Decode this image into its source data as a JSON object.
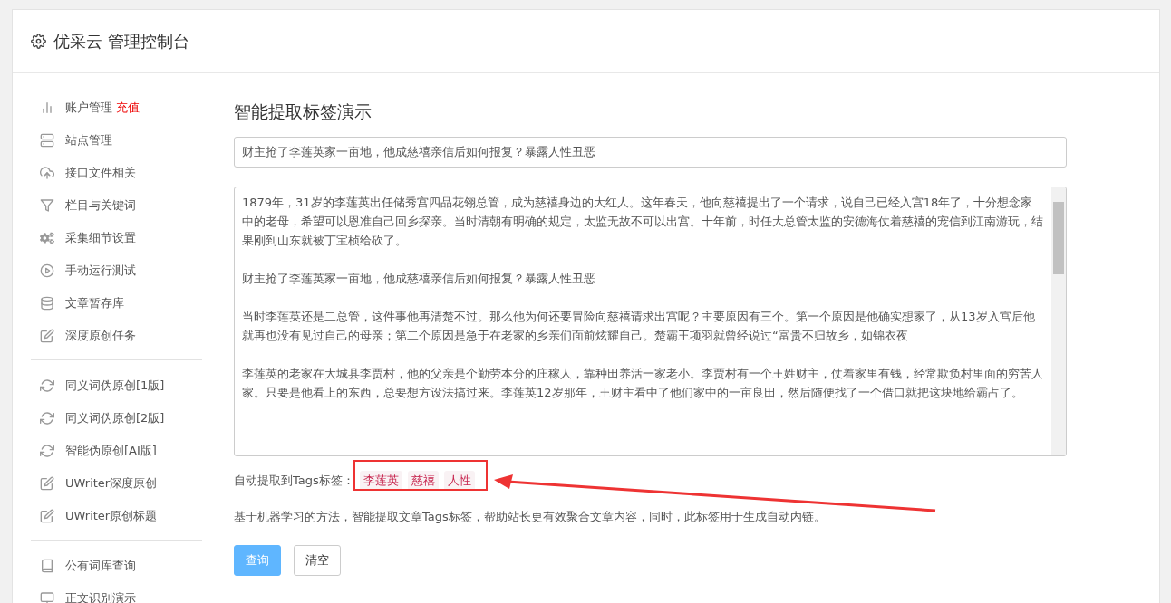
{
  "header": {
    "title": "优采云 管理控制台"
  },
  "sidebar": {
    "groups": [
      {
        "items": [
          {
            "label": "账户管理",
            "badge": "充值"
          },
          {
            "label": "站点管理"
          },
          {
            "label": "接口文件相关"
          },
          {
            "label": "栏目与关键词"
          },
          {
            "label": "采集细节设置"
          },
          {
            "label": "手动运行测试"
          },
          {
            "label": "文章暂存库"
          },
          {
            "label": "深度原创任务"
          }
        ]
      },
      {
        "items": [
          {
            "label": "同义词伪原创[1版]"
          },
          {
            "label": "同义词伪原创[2版]"
          },
          {
            "label": "智能伪原创[AI版]"
          },
          {
            "label": "UWriter深度原创"
          },
          {
            "label": "UWriter原创标题"
          }
        ]
      },
      {
        "items": [
          {
            "label": "公有词库查询"
          },
          {
            "label": "正文识别演示"
          }
        ]
      }
    ]
  },
  "main": {
    "title": "智能提取标签演示",
    "title_field": {
      "value": "财主抢了李莲英家一亩地，他成慈禧亲信后如何报复？暴露人性丑恶"
    },
    "content_paragraphs": [
      "1879年，31岁的李莲英出任储秀宫四品花翎总管，成为慈禧身边的大红人。这年春天，他向慈禧提出了一个请求，说自己已经入宫18年了，十分想念家中的老母，希望可以恩准自己回乡探亲。当时清朝有明确的规定，太监无故不可以出宫。十年前，时任大总管太监的安德海仗着慈禧的宠信到江南游玩，结果刚到山东就被丁宝桢给砍了。",
      "财主抢了李莲英家一亩地，他成慈禧亲信后如何报复？暴露人性丑恶",
      "当时李莲英还是二总管，这件事他再清楚不过。那么他为何还要冒险向慈禧请求出宫呢？主要原因有三个。第一个原因是他确实想家了，从13岁入宫后他就再也没有见过自己的母亲；第二个原因是急于在老家的乡亲们面前炫耀自己。楚霸王项羽就曾经说过“富贵不归故乡，如锦衣夜",
      "李莲英的老家在大城县李贾村，他的父亲是个勤劳本分的庄稼人，靠种田养活一家老小。李贾村有一个王姓财主，仗着家里有钱，经常欺负村里面的穷苦人家。只要是他看上的东西，总要想方设法搞过来。李莲英12岁那年，王财主看中了他们家中的一亩良田，然后随便找了一个借口就把这块地给霸占了。"
    ],
    "tags_label": "自动提取到Tags标签：",
    "tags": [
      "李莲英",
      "慈禧",
      "人性"
    ],
    "description": "基于机器学习的方法，智能提取文章Tags标签，帮助站长更有效聚合文章内容，同时，此标签用于生成自动内链。",
    "buttons": [
      {
        "label": "查询",
        "kind": "primary"
      },
      {
        "label": "清空",
        "kind": "default"
      }
    ]
  }
}
